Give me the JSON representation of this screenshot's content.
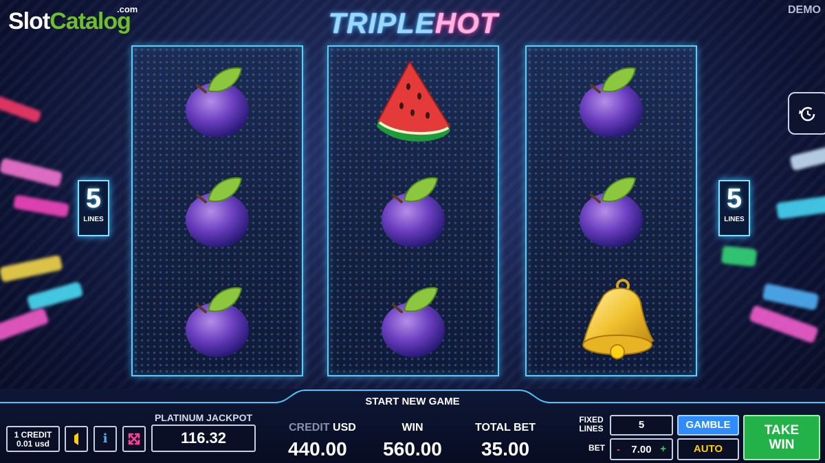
{
  "watermark": {
    "slot": "Slot",
    "catalog": "Catalog",
    "com": ".com"
  },
  "game_title": {
    "part1": "TRIPLE",
    "part2": "HOT"
  },
  "mode_label": "DEMO",
  "reels": [
    {
      "symbols": [
        "plum",
        "plum",
        "plum"
      ]
    },
    {
      "symbols": [
        "watermelon",
        "plum",
        "plum"
      ]
    },
    {
      "symbols": [
        "plum",
        "plum",
        "bell"
      ]
    }
  ],
  "lines_indicator": {
    "count": "5",
    "label": "LINES"
  },
  "start_new_game": "START NEW GAME",
  "credit_value": {
    "line1": "1 CREDIT",
    "line2": "0.01 usd"
  },
  "icons": {
    "sound": "speaker-icon",
    "info": "info-icon",
    "fullscreen": "fullscreen-icon",
    "history": "history-icon"
  },
  "jackpot": {
    "label": "PLATINUM JACKPOT",
    "value": "116.32"
  },
  "credit": {
    "label": "CREDIT",
    "currency": "USD",
    "value": "440.00"
  },
  "win": {
    "label": "WIN",
    "value": "560.00"
  },
  "total_bet": {
    "label": "TOTAL BET",
    "value": "35.00"
  },
  "fixed_lines": {
    "label1": "FIXED",
    "label2": "LINES",
    "value": "5"
  },
  "bet": {
    "label": "BET",
    "minus": "-",
    "value": "7.00",
    "plus": "+"
  },
  "buttons": {
    "gamble": "GAMBLE",
    "auto": "AUTO",
    "take_win_1": "TAKE",
    "take_win_2": "WIN"
  },
  "colors": {
    "accent_blue": "#2f8cff",
    "take_win_green": "#23b24a",
    "auto_yellow": "#ffd000",
    "reel_border": "#58d0ff"
  }
}
